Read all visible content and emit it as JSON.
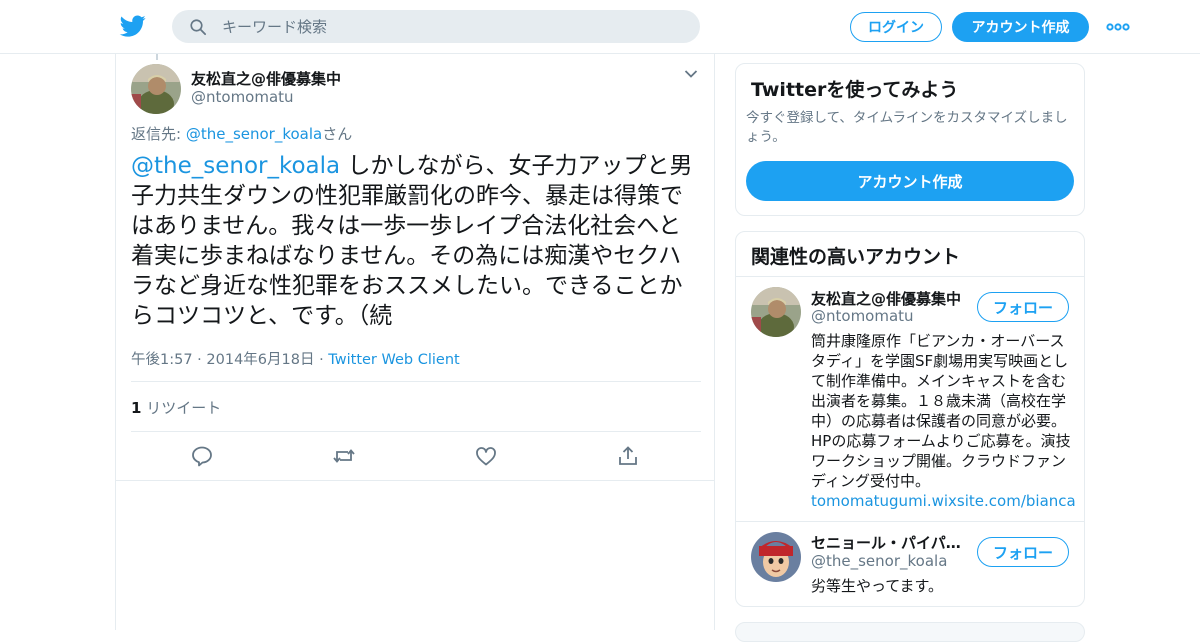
{
  "colors": {
    "brand": "#1da1f2",
    "link": "#1b95e0",
    "text": "#14171a",
    "secondary": "#657786",
    "border": "#e6ecf0"
  },
  "header": {
    "logo_icon": "twitter-bird-icon",
    "search": {
      "placeholder": "キーワード検索",
      "icon": "search-icon"
    },
    "login_label": "ログイン",
    "signup_label": "アカウント作成",
    "more_icon": "more-dots-icon"
  },
  "tweet": {
    "author": {
      "name": "友松直之@俳優募集中",
      "handle": "@ntomomatu"
    },
    "reply_prefix": "返信先: ",
    "reply_to": "@the_senor_koala",
    "reply_suffix": "さん",
    "mention": "@the_senor_koala",
    "body": " しかしながら、女子力アップと男子力共生ダウンの性犯罪厳罰化の昨今、暴走は得策ではありません。我々は一歩一歩レイプ合法化社会へと着実に歩まねばなりません。その為には痴漢やセクハラなど身近な性犯罪をおススメしたい。できることからコツコツと、です。（続",
    "timestamp": "午後1:57 · 2014年6月18日 · ",
    "source": "Twitter Web Client",
    "retweet_count": "1",
    "retweet_label": " リツイート",
    "actions": [
      "reply-icon",
      "retweet-icon",
      "like-icon",
      "share-icon"
    ]
  },
  "sidebar": {
    "signup_card": {
      "title": "Twitterを使ってみよう",
      "description": "今すぐ登録して、タイムラインをカスタマイズしましょう。",
      "button": "アカウント作成"
    },
    "related": {
      "title": "関連性の高いアカウント",
      "accounts": [
        {
          "name": "友松直之@俳優募集中",
          "handle": "@ntomomatu",
          "bio": "筒井康隆原作「ビアンカ・オーバースタディ」を学園SF劇場用実写映画として制作準備中。メインキャストを含む出演者を募集。１８歳未満（高校在学中）の応募者は保護者の同意が必要。HPの応募フォームよりご応募を。演技ワークショップ開催。クラウドファンディング受付中。",
          "bio_link": "tomomatugumi.wixsite.com/bianca",
          "follow": "フォロー"
        },
        {
          "name": "セニョール・パイパ…",
          "handle": "@the_senor_koala",
          "bio": "劣等生やってます。",
          "follow": "フォロー"
        }
      ]
    }
  }
}
